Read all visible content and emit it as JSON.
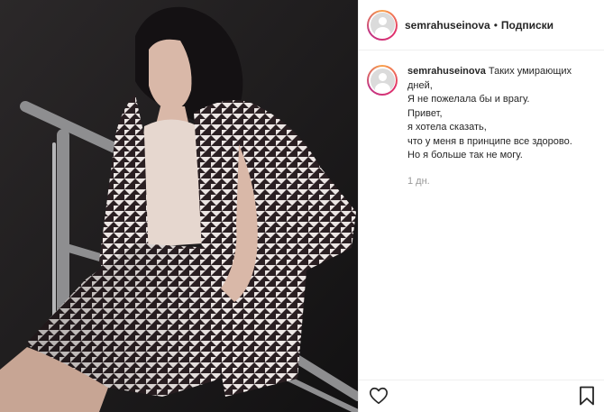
{
  "post": {
    "username": "semrahuseinova",
    "separator": "•",
    "follow_label": "Подписки",
    "caption_lines": [
      "Таких умирающих",
      "дней,",
      "Я не пожелала бы и врагу.",
      "Привет,",
      "я хотела сказать,",
      "что у меня в принципе все здорово.",
      "Но я больше так не могу."
    ],
    "time_ago": "1 дн."
  },
  "photo": {
    "pattern": "houndstooth",
    "colors": {
      "background": "#1b1a1b",
      "fabric_dark": "#2a1f22",
      "fabric_light": "#ece6e4",
      "skin": "#d9b8a8",
      "top": "#e6d7cf",
      "hair": "#141113",
      "rail": "#9a9a9c"
    }
  },
  "icons": {
    "like": "heart-icon",
    "save": "bookmark-icon"
  }
}
